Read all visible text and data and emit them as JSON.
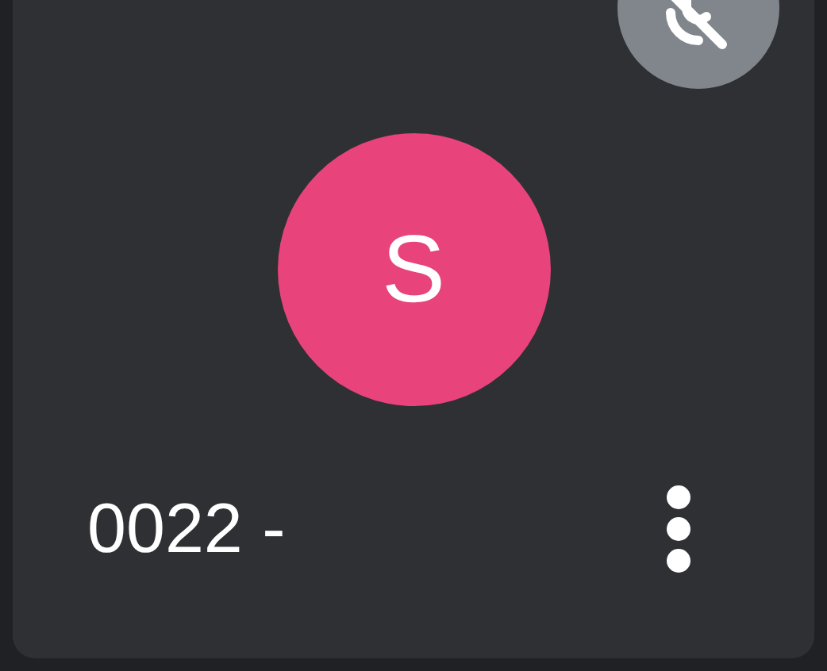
{
  "participant": {
    "initial": "S",
    "name": "0022 -",
    "muted": true
  }
}
